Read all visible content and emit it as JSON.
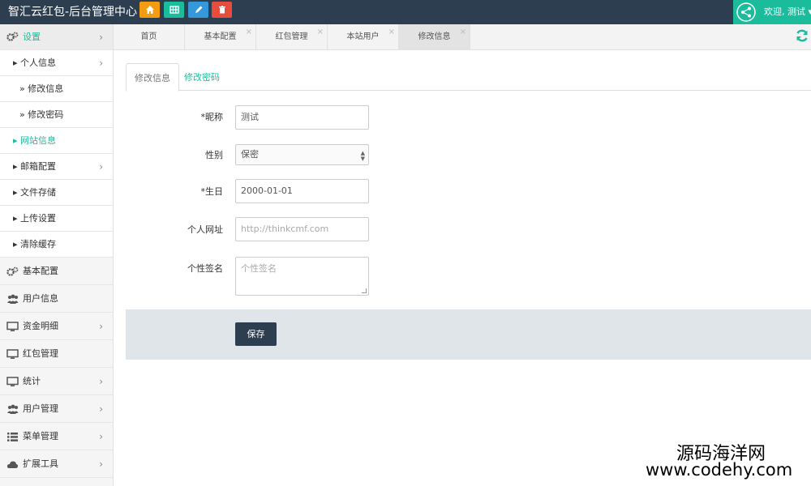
{
  "header": {
    "title": "智汇云红包-后台管理中心",
    "welcome": "欢迎, 测试",
    "buttons": [
      {
        "icon": "home-icon",
        "color": "#f39c12"
      },
      {
        "icon": "grid-icon",
        "color": "#1abc9c"
      },
      {
        "icon": "edit-icon",
        "color": "#3498db"
      },
      {
        "icon": "trash-icon",
        "color": "#e74c3c"
      }
    ]
  },
  "sidebar": {
    "items": [
      {
        "label": "设置",
        "icon": "gear-icon",
        "chevron": "›"
      },
      {
        "label": "个人信息",
        "chevron": "›"
      },
      {
        "label": "修改信息"
      },
      {
        "label": "修改密码"
      },
      {
        "label": "网站信息"
      },
      {
        "label": "邮箱配置",
        "chevron": "›"
      },
      {
        "label": "文件存储"
      },
      {
        "label": "上传设置"
      },
      {
        "label": "清除缓存"
      },
      {
        "label": "基本配置",
        "icon": "gear-icon"
      },
      {
        "label": "用户信息",
        "icon": "users-icon"
      },
      {
        "label": "资金明细",
        "icon": "monitor-icon",
        "chevron": "›"
      },
      {
        "label": "红包管理",
        "icon": "monitor-icon"
      },
      {
        "label": "统计",
        "icon": "monitor-icon",
        "chevron": "›"
      },
      {
        "label": "用户管理",
        "icon": "users-icon",
        "chevron": "›"
      },
      {
        "label": "菜单管理",
        "icon": "list-icon",
        "chevron": "›"
      },
      {
        "label": "扩展工具",
        "icon": "cloud-icon",
        "chevron": "›"
      }
    ]
  },
  "tabs": [
    {
      "label": "首页"
    },
    {
      "label": "基本配置",
      "close": "×"
    },
    {
      "label": "红包管理",
      "close": "×"
    },
    {
      "label": "本站用户",
      "close": "×"
    },
    {
      "label": "修改信息",
      "close": "×"
    }
  ],
  "subtabs": {
    "edit_info": "修改信息",
    "change_password": "修改密码"
  },
  "form": {
    "nickname_label": "*昵称",
    "nickname_value": "测试",
    "gender_label": "性别",
    "gender_value": "保密",
    "birthday_label": "*生日",
    "birthday_value": "2000-01-01",
    "website_label": "个人网址",
    "website_placeholder": "http://thinkcmf.com",
    "signature_label": "个性签名",
    "signature_placeholder": "个性签名",
    "save_label": "保存"
  },
  "watermark": {
    "line1": "源码海洋网",
    "line2": "www.codehy.com"
  },
  "colors": {
    "accent": "#1abc9c",
    "dark": "#2c3e50"
  }
}
